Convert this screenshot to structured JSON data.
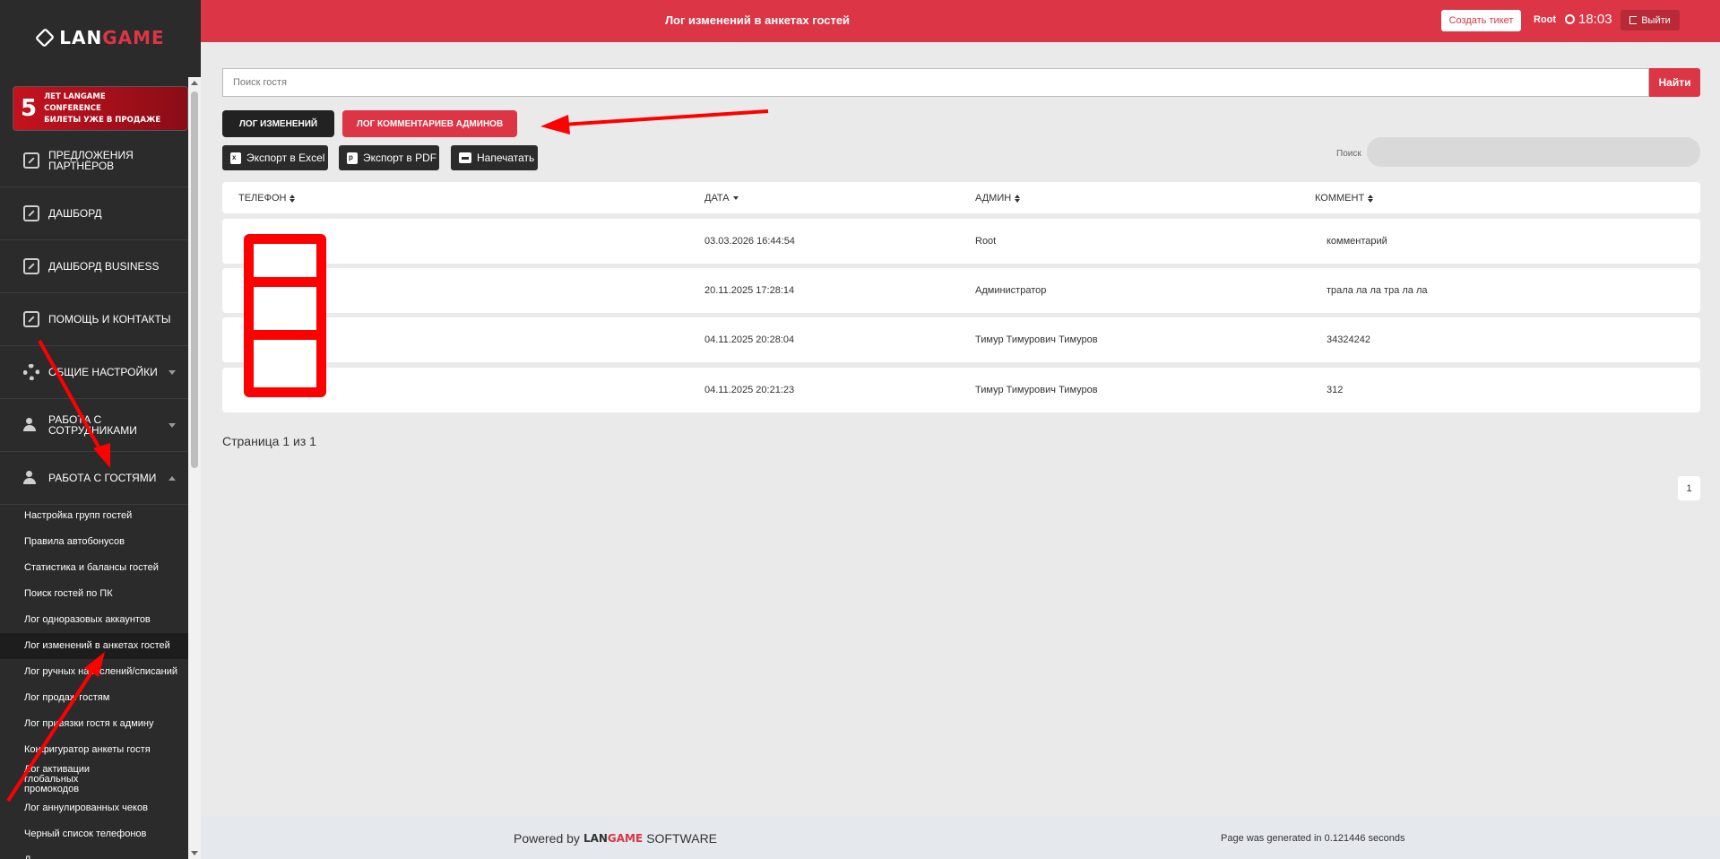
{
  "sidebar": {
    "logo": {
      "part1": "LAN",
      "part2": "GAME"
    },
    "promo": {
      "number": "5",
      "line1": "ЛЕТ LANGAME",
      "line2": "CONFERENCE",
      "line3": "БИЛЕТЫ УЖЕ В ПРОДАЖЕ"
    },
    "menu": [
      {
        "label": "Предложения партнёров"
      },
      {
        "label": "Дашборд"
      },
      {
        "label": "Дашборд Business"
      },
      {
        "label": "Помощь и контакты"
      },
      {
        "label": "Общие настройки"
      },
      {
        "label": "Работа с сотрудниками"
      },
      {
        "label": "Работа с гостями"
      }
    ],
    "submenu": [
      "Настройка групп гостей",
      "Правила автобонусов",
      "Статистика и балансы гостей",
      "Поиск гостей по ПК",
      "Лог одноразовых аккаунтов",
      "Лог изменений в анкетах гостей",
      "Лог ручных начислений/списаний",
      "Лог продаж гостям",
      "Лог привязки гостя к админу",
      "Конфигуратор анкеты гостя",
      "Лог активации глобальных промокодов",
      "Лог аннулированных чеков",
      "Черный список телефонов",
      "Д..."
    ]
  },
  "header": {
    "title": "Лог изменений в анкетах гостей",
    "ticket": "Создать тикет",
    "user": "Root",
    "time": "18:03",
    "logout": "Выйти"
  },
  "search": {
    "placeholder": "Поиск гостя",
    "button": "Найти"
  },
  "tabs": {
    "changes": "Лог изменений",
    "comments": "Лог комментариев админов"
  },
  "export": {
    "excel": "Экспорт в Excel",
    "pdf": "Экспорт в PDF",
    "print": "Напечатать"
  },
  "filter": {
    "label": "Поиск"
  },
  "table": {
    "headers": {
      "phone": "Телефон",
      "date": "Дата",
      "admin": "Админ",
      "comment": "Коммент"
    },
    "rows": [
      {
        "date": "03.03.2026 16:44:54",
        "admin": "Root",
        "comment": "комментарий"
      },
      {
        "date": "20.11.2025 17:28:14",
        "admin": "Администратор",
        "comment": "трала ла ла тра ла ла"
      },
      {
        "date": "04.11.2025 20:28:04",
        "admin": "Тимур Тимурович Тимуров",
        "comment": "34324242"
      },
      {
        "date": "04.11.2025 20:21:23",
        "admin": "Тимур Тимурович Тимуров",
        "comment": "312"
      }
    ]
  },
  "pager": {
    "text": "Страница 1 из 1",
    "page": "1"
  },
  "footer": {
    "powered_prefix": "Powered by",
    "brand1": "LAN",
    "brand2": "GAME",
    "powered_suffix": "SOFTWARE",
    "generated": "Page was generated in 0.121446 seconds"
  },
  "colors": {
    "accent": "#dc3545",
    "sidebar": "#2b2b2b",
    "annotation": "#ff0000"
  }
}
